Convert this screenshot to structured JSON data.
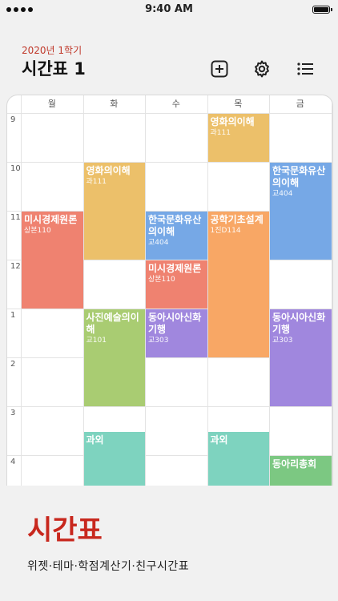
{
  "status": {
    "time": "9:40 AM"
  },
  "header": {
    "semester": "2020년 1학기",
    "title": "시간표 1",
    "icons": [
      "add-square-icon",
      "gear-icon",
      "list-icon"
    ]
  },
  "timetable": {
    "days": [
      "월",
      "화",
      "수",
      "목",
      "금"
    ],
    "hours": [
      "9",
      "10",
      "11",
      "12",
      "1",
      "2",
      "3",
      "4"
    ],
    "events": [
      {
        "name": "미시경제원론",
        "room": "상본110",
        "day": 0,
        "start": 11,
        "end": 13,
        "color": "#ef8270"
      },
      {
        "name": "영화의이해",
        "room": "과111",
        "day": 1,
        "start": 10,
        "end": 12,
        "color": "#ecc06a"
      },
      {
        "name": "사진예술의이해",
        "room": "교101",
        "day": 1,
        "start": 13,
        "end": 15,
        "color": "#a9cc72"
      },
      {
        "name": "과외",
        "room": "",
        "day": 1,
        "start": 15.5,
        "end": 17,
        "color": "#7ed3bf"
      },
      {
        "name": "한국문화유산의이해",
        "room": "교404",
        "day": 2,
        "start": 11,
        "end": 12,
        "color": "#76a8e6"
      },
      {
        "name": "미시경제원론",
        "room": "상본110",
        "day": 2,
        "start": 12,
        "end": 13,
        "color": "#ef8270"
      },
      {
        "name": "동아시아신화기행",
        "room": "교303",
        "day": 2,
        "start": 13,
        "end": 14,
        "color": "#a087de"
      },
      {
        "name": "영화의이해",
        "room": "과111",
        "day": 3,
        "start": 9,
        "end": 10,
        "color": "#ecc06a"
      },
      {
        "name": "공학기초설계",
        "room": "1진D114",
        "day": 3,
        "start": 11,
        "end": 14,
        "color": "#f8a765"
      },
      {
        "name": "과외",
        "room": "",
        "day": 3,
        "start": 15.5,
        "end": 17,
        "color": "#7ed3bf"
      },
      {
        "name": "한국문화유산의이해",
        "room": "교404",
        "day": 4,
        "start": 10,
        "end": 12,
        "color": "#76a8e6"
      },
      {
        "name": "동아시아신화기행",
        "room": "교303",
        "day": 4,
        "start": 13,
        "end": 15,
        "color": "#a087de"
      },
      {
        "name": "동아리총회",
        "room": "",
        "day": 4,
        "start": 16,
        "end": 17,
        "color": "#7cc882"
      }
    ]
  },
  "promo": {
    "title": "시간표",
    "subtitle": "위젯·테마·학점계산기·친구시간표"
  }
}
